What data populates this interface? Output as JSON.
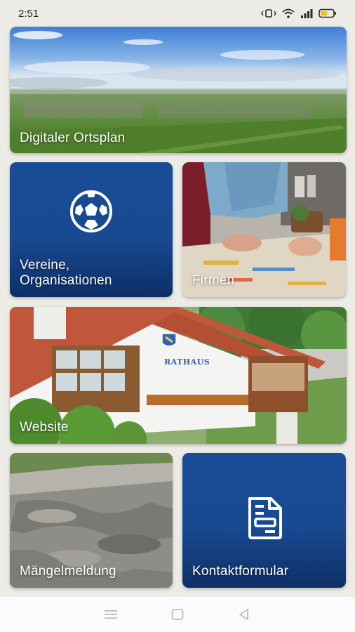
{
  "status_bar": {
    "time": "2:51",
    "icons": [
      "vibrate-icon",
      "wifi-icon",
      "signal-icon",
      "battery-icon"
    ]
  },
  "tiles": {
    "ortsplan": {
      "label": "Digitaler Ortsplan",
      "image": "aerial-landscape-photo"
    },
    "vereine": {
      "label": "Vereine,\nOrganisationen",
      "icon": "soccer-ball-icon"
    },
    "firmen": {
      "label": "Firmen",
      "image": "business-meeting-photo"
    },
    "website": {
      "label": "Website",
      "image": "town-hall-photo"
    },
    "maengel": {
      "label": "Mängelmeldung",
      "image": "damaged-road-photo"
    },
    "kontakt": {
      "label": "Kontaktformular",
      "icon": "form-document-icon"
    }
  },
  "photo_text": {
    "rathaus_sign": "RATHAUS"
  },
  "colors": {
    "tile_blue": "#1a4b96",
    "background": "#ecebe6",
    "battery": "#f2c318"
  },
  "nav_bar": {
    "buttons": [
      "menu-icon",
      "home-icon",
      "back-icon"
    ]
  }
}
